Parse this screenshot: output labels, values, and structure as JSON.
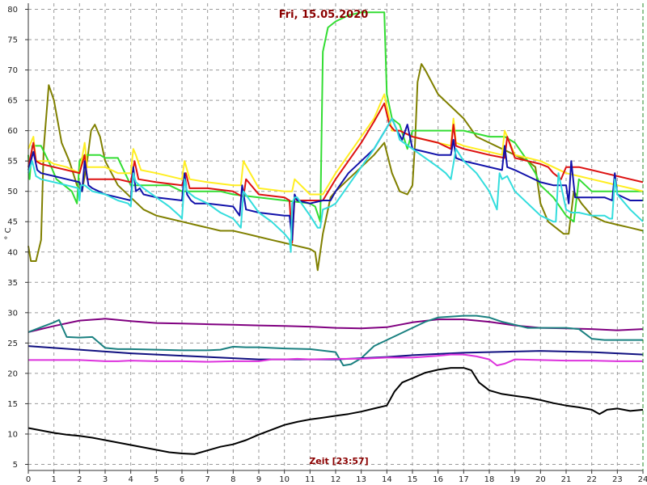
{
  "chart_data": {
    "type": "line",
    "title": "Fri, 15.05.2020",
    "xlabel": "Zeit [23:57]",
    "ylabel": "° C",
    "xlim": [
      0,
      24
    ],
    "ylim": [
      4,
      81
    ],
    "x_ticks": [
      "0",
      "1",
      "2",
      "3",
      "4",
      "5",
      "6",
      "7",
      "8",
      "9",
      "10",
      "11",
      "12",
      "13",
      "14",
      "15",
      "16",
      "17",
      "18",
      "19",
      "20",
      "21",
      "22",
      "23",
      "24"
    ],
    "y_ticks": [
      "5",
      "10",
      "15",
      "20",
      "25",
      "30",
      "35",
      "40",
      "45",
      "50",
      "55",
      "60",
      "65",
      "70",
      "75",
      "80"
    ],
    "grid": true,
    "plot_background": "#ffffff",
    "grid_color": "#9a9a9a",
    "series": [
      {
        "color": "#808000",
        "x": [
          0,
          0.1,
          0.3,
          0.5,
          0.6,
          0.8,
          1.0,
          1.3,
          1.6,
          1.9,
          2.1,
          2.3,
          2.45,
          2.6,
          2.8,
          3.0,
          3.5,
          4.0,
          4.5,
          5.0,
          5.5,
          6.0,
          6.5,
          7.0,
          7.5,
          8.0,
          8.5,
          9.0,
          9.5,
          10.0,
          10.5,
          11.0,
          11.2,
          11.3,
          11.5,
          11.8,
          12.0,
          12.5,
          13.0,
          13.5,
          13.9,
          14.2,
          14.5,
          14.8,
          15.0,
          15.1,
          15.2,
          15.35,
          15.5,
          16.0,
          16.5,
          17.0,
          17.5,
          18.0,
          18.5,
          19.0,
          19.5,
          19.8,
          20.0,
          20.3,
          20.6,
          20.9,
          21.1,
          21.3,
          21.6,
          22.0,
          22.5,
          23.0,
          23.5,
          24.0
        ],
        "y": [
          41,
          38.5,
          38.5,
          42,
          57,
          67.5,
          65,
          58,
          55,
          51,
          50,
          55,
          60,
          61,
          59,
          55,
          51,
          49,
          47,
          46,
          45.5,
          45,
          44.5,
          44,
          43.5,
          43.5,
          43,
          42.5,
          42,
          41.5,
          41,
          40.5,
          40,
          37,
          43,
          49,
          50,
          52,
          54,
          56,
          58,
          53,
          50,
          49.5,
          51,
          58,
          68,
          71,
          70,
          66,
          64,
          62,
          59,
          58,
          57,
          56,
          55,
          54,
          48,
          45,
          44,
          43,
          43,
          50,
          48,
          46,
          45,
          44.5,
          44,
          43.5
        ]
      },
      {
        "color": "#33dd33",
        "x": [
          0,
          0.05,
          0.15,
          0.5,
          0.9,
          1.1,
          1.4,
          1.7,
          1.9,
          2.0,
          2.2,
          2.5,
          2.8,
          3.0,
          3.5,
          4.0,
          4.2,
          4.4,
          5.0,
          5.5,
          6.0,
          6.5,
          7.0,
          7.5,
          8.0,
          9.0,
          10.0,
          11.0,
          11.2,
          11.4,
          11.5,
          11.7,
          12.0,
          12.5,
          13.0,
          13.5,
          13.9,
          14.0,
          14.2,
          14.5,
          14.8,
          15.0,
          15.3,
          15.8,
          16.5,
          17.0,
          17.5,
          18.0,
          18.6,
          19.0,
          19.5,
          19.8,
          20.0,
          20.5,
          21.0,
          21.3,
          21.5,
          22.0,
          22.5,
          23.0,
          23.5,
          24.0
        ],
        "y": [
          56,
          52,
          57.5,
          57.5,
          54,
          52,
          51,
          50,
          48,
          55,
          56,
          56,
          56,
          55.5,
          55.5,
          51,
          51,
          51,
          51,
          51,
          50,
          50,
          50,
          50,
          49.5,
          49,
          48.5,
          48,
          47.5,
          45,
          73,
          77,
          78,
          79,
          79.5,
          79.5,
          79.5,
          66,
          62,
          61,
          57,
          60,
          60,
          60,
          60,
          60,
          59.5,
          59,
          59,
          58,
          55,
          53,
          51,
          49,
          46,
          45,
          52,
          50,
          50,
          50,
          50,
          50
        ]
      },
      {
        "color": "#ffee22",
        "x": [
          0,
          0.2,
          0.3,
          0.5,
          0.8,
          1.0,
          1.5,
          2.0,
          2.2,
          2.3,
          2.5,
          2.8,
          3.0,
          3.5,
          4.0,
          4.1,
          4.2,
          4.4,
          5.0,
          6.0,
          6.1,
          6.3,
          7.0,
          8.0,
          8.3,
          8.4,
          9.0,
          10.0,
          10.3,
          10.4,
          11.0,
          11.5,
          12.0,
          12.5,
          13.0,
          13.5,
          13.9,
          14.2,
          14.5,
          15.0,
          15.5,
          16.0,
          16.5,
          16.6,
          16.7,
          17.0,
          17.5,
          18.0,
          18.5,
          18.6,
          19.0,
          19.5,
          20.0,
          20.5,
          21.0,
          21.5,
          22.0,
          22.5,
          23.0,
          23.5,
          24.0
        ],
        "y": [
          57,
          59,
          55,
          55,
          55,
          54.5,
          54,
          53,
          58,
          54,
          54,
          54,
          54,
          53,
          53,
          57,
          56,
          53.5,
          53,
          52,
          55,
          52,
          51.5,
          51,
          51,
          55,
          50.5,
          50,
          50,
          52,
          49.5,
          49.5,
          53,
          56,
          59,
          62,
          66,
          60,
          60,
          59,
          58.5,
          58,
          57.5,
          62,
          58,
          57.5,
          57,
          56.5,
          56,
          60,
          56,
          55.5,
          55,
          54,
          53,
          52.5,
          52,
          51.5,
          51,
          50.5,
          50
        ]
      },
      {
        "color": "#dd1111",
        "x": [
          0,
          0.2,
          0.3,
          0.5,
          1.0,
          1.5,
          2.0,
          2.2,
          2.3,
          2.5,
          3.0,
          3.5,
          4.0,
          4.15,
          4.3,
          5.0,
          6.0,
          6.15,
          6.3,
          7.0,
          8.0,
          8.4,
          8.5,
          9.0,
          10.0,
          10.2,
          10.3,
          10.4,
          10.5,
          11.0,
          11.5,
          12.0,
          12.5,
          13.0,
          13.5,
          13.9,
          14.1,
          14.3,
          14.5,
          15.0,
          15.5,
          16.0,
          16.5,
          16.6,
          16.7,
          17.0,
          17.5,
          18.0,
          18.6,
          18.7,
          19.0,
          19.5,
          20.0,
          20.3,
          20.5,
          20.8,
          21.0,
          21.5,
          22.0,
          22.5,
          23.0,
          23.5,
          24.0
        ],
        "y": [
          54,
          58,
          55,
          54.5,
          54,
          53.5,
          53,
          56,
          52,
          52,
          52,
          52,
          51.5,
          55,
          52,
          51.5,
          51,
          53,
          50.5,
          50.5,
          50,
          49,
          52,
          49.5,
          49,
          48.5,
          41.5,
          49,
          48.5,
          48.5,
          48.5,
          52,
          55,
          58,
          61.5,
          64.5,
          61,
          60,
          60,
          59,
          58.5,
          58,
          57,
          61,
          57.5,
          57,
          56.5,
          56,
          55.5,
          59,
          55.5,
          55,
          54.5,
          54,
          53,
          52,
          54,
          54,
          53.5,
          53,
          52.5,
          52,
          51.5
        ]
      },
      {
        "color": "#1111aa",
        "x": [
          0,
          0.2,
          0.35,
          0.5,
          1.0,
          1.5,
          2.0,
          2.1,
          2.2,
          2.35,
          2.5,
          3.0,
          3.5,
          4.0,
          4.1,
          4.2,
          4.35,
          4.5,
          5.0,
          6.0,
          6.1,
          6.2,
          6.35,
          6.5,
          7.0,
          8.0,
          8.25,
          8.35,
          8.5,
          9.0,
          10.0,
          10.2,
          10.3,
          10.4,
          10.5,
          11.0,
          11.5,
          11.8,
          12.0,
          12.5,
          13.0,
          13.5,
          14.0,
          14.2,
          14.4,
          14.6,
          14.8,
          15.0,
          15.5,
          16.0,
          16.5,
          16.6,
          16.7,
          17.0,
          17.5,
          18.0,
          18.5,
          18.6,
          18.7,
          19.0,
          19.5,
          20.0,
          20.5,
          21.0,
          21.1,
          21.2,
          21.35,
          21.5,
          22.0,
          22.5,
          22.8,
          22.9,
          23.0,
          23.5,
          24.0
        ],
        "y": [
          53.5,
          56.5,
          53.5,
          53,
          52.5,
          52,
          51.5,
          50,
          55,
          51,
          50.5,
          49.5,
          49,
          48.5,
          54,
          50,
          50.5,
          49.5,
          49,
          48.5,
          53,
          49.5,
          48.5,
          48,
          48,
          47.5,
          46,
          51,
          47,
          46.5,
          46,
          46,
          42,
          49.5,
          48.5,
          48,
          48.5,
          48.5,
          50,
          53,
          55,
          57,
          60.5,
          62,
          60,
          58.5,
          61,
          57,
          56.5,
          56,
          56,
          58.5,
          55.5,
          55,
          54.5,
          54,
          53.5,
          57.5,
          54,
          53.5,
          52.5,
          51.5,
          51,
          51,
          48,
          55,
          49,
          49,
          49,
          49,
          48.5,
          53,
          49.5,
          48.5,
          48.5
        ]
      },
      {
        "color": "#33dddd",
        "x": [
          0,
          0.15,
          0.3,
          0.5,
          1.0,
          1.5,
          1.95,
          2.0,
          2.05,
          2.2,
          2.5,
          3.0,
          3.5,
          3.9,
          4.0,
          4.1,
          4.2,
          4.5,
          5.0,
          5.5,
          5.9,
          6.0,
          6.1,
          6.2,
          6.5,
          7.0,
          7.5,
          8.0,
          8.2,
          8.3,
          8.4,
          9.0,
          9.5,
          10.0,
          10.2,
          10.25,
          10.3,
          10.4,
          10.5,
          11.0,
          11.3,
          11.4,
          11.5,
          11.8,
          12.0,
          12.5,
          13.0,
          13.5,
          14.0,
          14.2,
          14.4,
          14.5,
          15.0,
          15.5,
          16.0,
          16.3,
          16.4,
          16.5,
          16.7,
          17.0,
          17.5,
          18.0,
          18.3,
          18.4,
          18.5,
          18.7,
          19.0,
          19.5,
          20.0,
          20.5,
          20.6,
          20.7,
          20.9,
          21.0,
          21.2,
          21.5,
          22.0,
          22.5,
          22.7,
          22.8,
          22.9,
          23.0,
          23.5,
          24.0
        ],
        "y": [
          53,
          55,
          52.5,
          52,
          51.5,
          51,
          50.5,
          48.5,
          51,
          51,
          50,
          49.5,
          48.5,
          48,
          47.5,
          53,
          51.5,
          50.5,
          49,
          47.5,
          46,
          45.5,
          52,
          50,
          49,
          48,
          46.5,
          45.5,
          44.5,
          44,
          50,
          46.5,
          45,
          43,
          42,
          40,
          48,
          49,
          49,
          46,
          44,
          44,
          47,
          47.5,
          48,
          51,
          54,
          57,
          60.5,
          62,
          60,
          58.5,
          57,
          55.5,
          54,
          53,
          52.5,
          52,
          57,
          55,
          53,
          50,
          47,
          53,
          52,
          52.5,
          50,
          48,
          46,
          45,
          45,
          53,
          49,
          47,
          46.5,
          46.5,
          46,
          46,
          45.5,
          45.5,
          52,
          49.5,
          47,
          45
        ]
      },
      {
        "color": "#800080",
        "x": [
          0,
          1,
          2,
          3,
          4,
          5,
          6,
          7,
          8,
          9,
          10,
          11,
          12,
          13,
          14,
          15,
          16,
          17,
          18,
          19,
          20,
          21,
          22,
          23,
          24
        ],
        "y": [
          26.8,
          27.8,
          28.7,
          29.0,
          28.6,
          28.3,
          28.2,
          28.1,
          28.0,
          27.9,
          27.8,
          27.7,
          27.5,
          27.4,
          27.6,
          28.4,
          28.9,
          28.9,
          28.5,
          27.9,
          27.5,
          27.4,
          27.3,
          27.1,
          27.3
        ]
      },
      {
        "color": "#1a8080",
        "x": [
          0,
          0.5,
          1.0,
          1.2,
          1.5,
          2.0,
          2.5,
          3.0,
          3.5,
          4.0,
          5.0,
          6.0,
          7.0,
          7.5,
          8.0,
          8.5,
          9.0,
          10.0,
          11.0,
          12.0,
          12.3,
          12.6,
          13.0,
          13.5,
          14.0,
          14.5,
          15.0,
          15.5,
          16.0,
          17.0,
          17.5,
          18.0,
          18.5,
          19.0,
          19.5,
          20.0,
          21.0,
          21.5,
          22.0,
          22.5,
          23.0,
          24.0
        ],
        "y": [
          26.8,
          27.6,
          28.4,
          28.8,
          26.0,
          25.9,
          26.0,
          24.2,
          24.0,
          24.0,
          23.9,
          23.8,
          23.8,
          23.9,
          24.4,
          24.3,
          24.3,
          24.1,
          24.0,
          23.5,
          21.3,
          21.5,
          22.5,
          24.5,
          25.5,
          26.5,
          27.5,
          28.5,
          29.2,
          29.5,
          29.5,
          29.2,
          28.5,
          28.0,
          27.5,
          27.5,
          27.5,
          27.3,
          25.7,
          25.5,
          25.5,
          25.5
        ]
      },
      {
        "color": "#101080",
        "x": [
          0,
          1,
          2,
          3,
          4,
          5,
          6,
          7,
          8,
          9,
          10,
          11,
          12,
          13,
          14,
          15,
          16,
          17,
          18,
          19,
          20,
          21,
          22,
          23,
          24
        ],
        "y": [
          24.5,
          24.2,
          23.9,
          23.6,
          23.3,
          23.1,
          22.9,
          22.7,
          22.5,
          22.3,
          22.3,
          22.3,
          22.3,
          22.5,
          22.7,
          23.0,
          23.2,
          23.4,
          23.5,
          23.6,
          23.7,
          23.6,
          23.5,
          23.3,
          23.1
        ]
      },
      {
        "color": "#dd33dd",
        "x": [
          0,
          1,
          2,
          3,
          3.5,
          4,
          5,
          6,
          7,
          8,
          9,
          9.5,
          10,
          10.5,
          11,
          12,
          13,
          14,
          15,
          16,
          16.5,
          17,
          17.5,
          18,
          18.3,
          18.6,
          19,
          20,
          21,
          22,
          23,
          24
        ],
        "y": [
          22.2,
          22.2,
          22.2,
          22.0,
          22.0,
          22.1,
          22.0,
          22.0,
          21.9,
          22.0,
          22.0,
          22.3,
          22.3,
          22.4,
          22.3,
          22.4,
          22.4,
          22.6,
          22.6,
          22.9,
          23.1,
          23.1,
          22.8,
          22.3,
          21.3,
          21.6,
          22.3,
          22.2,
          22.1,
          22.1,
          22.0,
          22.0
        ]
      },
      {
        "color": "#000000",
        "x": [
          0,
          0.5,
          1.0,
          1.5,
          2.0,
          2.5,
          3.0,
          3.5,
          4.0,
          4.5,
          5.0,
          5.5,
          6.0,
          6.5,
          7.0,
          7.5,
          8.0,
          8.5,
          9.0,
          9.5,
          10.0,
          10.5,
          11.0,
          11.5,
          12.0,
          12.5,
          13.0,
          13.5,
          14.0,
          14.3,
          14.6,
          15.0,
          15.5,
          16.0,
          16.5,
          17.0,
          17.3,
          17.6,
          18.0,
          18.5,
          19.0,
          19.5,
          20.0,
          20.5,
          21.0,
          21.5,
          22.0,
          22.3,
          22.6,
          23.0,
          23.5,
          24.0
        ],
        "y": [
          11.0,
          10.6,
          10.2,
          9.9,
          9.7,
          9.4,
          9.0,
          8.6,
          8.2,
          7.8,
          7.4,
          7.0,
          6.8,
          6.7,
          7.3,
          7.9,
          8.3,
          9.0,
          9.9,
          10.7,
          11.5,
          12.0,
          12.4,
          12.7,
          13.0,
          13.3,
          13.7,
          14.2,
          14.7,
          17.0,
          18.5,
          19.2,
          20.1,
          20.6,
          20.9,
          20.9,
          20.5,
          18.5,
          17.2,
          16.6,
          16.3,
          16.0,
          15.6,
          15.1,
          14.7,
          14.4,
          14.0,
          13.3,
          14.0,
          14.2,
          13.8,
          14.0
        ]
      }
    ]
  }
}
